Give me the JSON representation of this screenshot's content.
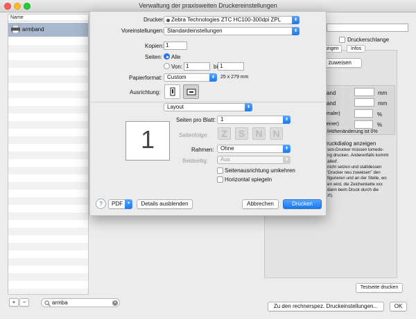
{
  "window": {
    "title": "Verwaltung der praxisweiten Druckereinstellungen"
  },
  "list": {
    "header": "Name",
    "items": [
      {
        "label": "armband"
      }
    ]
  },
  "bottom": {
    "add": "+",
    "remove": "−",
    "search_value": "armba",
    "details_button": "Zu den rechnerspez. Druckeinstellungen...",
    "ok_button": "OK"
  },
  "right": {
    "queue_checkbox": "Druckerschlange",
    "tabs": [
      "ungen",
      "Infos"
    ],
    "assign_button": "u zuweisen",
    "text1": "are",
    "text2": "s",
    "margin_rows": [
      {
        "label": "en Rand",
        "value": "",
        "unit": "mm"
      },
      {
        "label": "en Rand",
        "value": "",
        "unit": "mm"
      },
      {
        "label": "= schmaler)",
        "value": "",
        "unit": "%"
      },
      {
        "label": "e = kleiner)",
        "value": "",
        "unit": "%"
      }
    ],
    "note1": "eiten-/Höhenänderung ist 0%",
    "heading": "er Druckdialog anzeigen",
    "desc_lines": [
      "son-Drucker müssen tomedo-",
      "ng drucken. Anderenfalls kommt",
      "alled'.",
      "nicht setzen und stattdessen",
      "'Drucker neu zuweisen\" den",
      "figurieren und an der Stelle, wo",
      "en wird, die Zeichenkette xxx",
      "dann beim Druck durch die",
      "zt)."
    ],
    "test_button": "Testseite drucken"
  },
  "dialog": {
    "printer": {
      "label": "Drucker:",
      "value": "Zebra Technologies ZTC HC100-300dpi ZPL"
    },
    "presets": {
      "label": "Voreinstellungen:",
      "value": "Standardeinstellungen"
    },
    "copies": {
      "label": "Kopien:",
      "value": "1"
    },
    "pages": {
      "label": "Seiten:",
      "all": "Alle",
      "from_label": "Von:",
      "from_value": "1",
      "to_label": "bis:",
      "to_value": "1"
    },
    "paper": {
      "label": "Papierformat:",
      "value": "Custom",
      "size": "25 x 279 mm"
    },
    "orientation": {
      "label": "Ausrichtung:"
    },
    "section": {
      "value": "Layout"
    },
    "preview_number": "1",
    "pages_per_sheet": {
      "label": "Seiten pro Blatt:",
      "value": "1"
    },
    "page_order": {
      "label": "Seitenfolge:"
    },
    "border": {
      "label": "Rahmen:",
      "value": "Ohne"
    },
    "duplex": {
      "label": "Beidseitig:",
      "value": "Aus"
    },
    "reverse_orientation": "Seitenausrichtung umkehren",
    "flip_horizontal": "Horizontal spiegeln",
    "help": "?",
    "pdf": "PDF",
    "hide_details": "Details ausblenden",
    "cancel": "Abbrechen",
    "print": "Drucken"
  },
  "colors": {
    "accent": "#1a78f0",
    "selection": "#a9b8ce"
  }
}
